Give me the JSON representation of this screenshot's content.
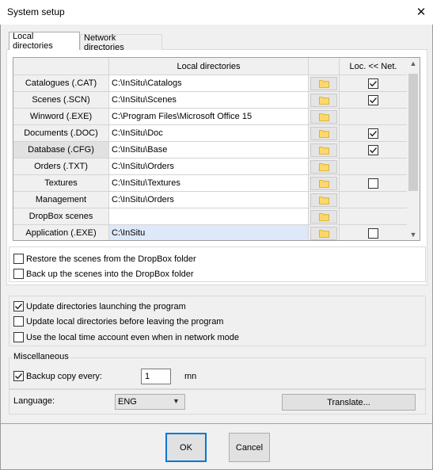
{
  "window": {
    "title": "System setup",
    "close_glyph": "✕"
  },
  "tabs": [
    {
      "label": "Local directories",
      "active": true
    },
    {
      "label": "Network directories",
      "active": false
    }
  ],
  "grid": {
    "header": {
      "col_path": "Local directories",
      "col_sync": "Loc. << Net."
    },
    "rows": [
      {
        "label": "Catalogues (.CAT)",
        "path": "C:\\InSitu\\Catalogs",
        "checkbox": "checked"
      },
      {
        "label": "Scenes (.SCN)",
        "path": "C:\\InSitu\\Scenes",
        "checkbox": "checked"
      },
      {
        "label": "Winword (.EXE)",
        "path": "C:\\Program Files\\Microsoft Office 15",
        "checkbox": "none"
      },
      {
        "label": "Documents (.DOC)",
        "path": "C:\\InSitu\\Doc",
        "checkbox": "checked"
      },
      {
        "label": "Database (.CFG)",
        "path": "C:\\InSitu\\Base",
        "checkbox": "checked"
      },
      {
        "label": "Orders (.TXT)",
        "path": "C:\\InSitu\\Orders",
        "checkbox": "none"
      },
      {
        "label": "Textures",
        "path": "C:\\InSitu\\Textures",
        "checkbox": "unchecked"
      },
      {
        "label": "Management",
        "path": "C:\\InSitu\\Orders",
        "checkbox": "none"
      },
      {
        "label": "DropBox scenes",
        "path": "",
        "checkbox": "none"
      },
      {
        "label": "Application (.EXE)",
        "path": "C:\\InSitu",
        "checkbox": "unchecked"
      }
    ]
  },
  "dropbox_options": {
    "restore_label": "Restore the scenes from the DropBox folder",
    "restore_checked": false,
    "backup_label": "Back up the scenes into the DropBox folder",
    "backup_checked": false
  },
  "general_options": {
    "update_launch_label": "Update directories launching the program",
    "update_launch_checked": true,
    "update_leave_label": "Update local directories before leaving the program",
    "update_leave_checked": false,
    "local_time_label": "Use the local time account even when in network mode",
    "local_time_checked": false
  },
  "misc": {
    "group_label": "Miscellaneous",
    "backup_label": "Backup copy every:",
    "backup_checked": true,
    "backup_value": "1",
    "backup_unit": "mn"
  },
  "language": {
    "label": "Language:",
    "selected": "ENG",
    "translate_label": "Translate..."
  },
  "footer": {
    "ok_label": "OK",
    "cancel_label": "Cancel"
  },
  "colors": {
    "accent": "#0078d7",
    "selected_row": "#dde8f9",
    "folder": "#ffd966"
  }
}
